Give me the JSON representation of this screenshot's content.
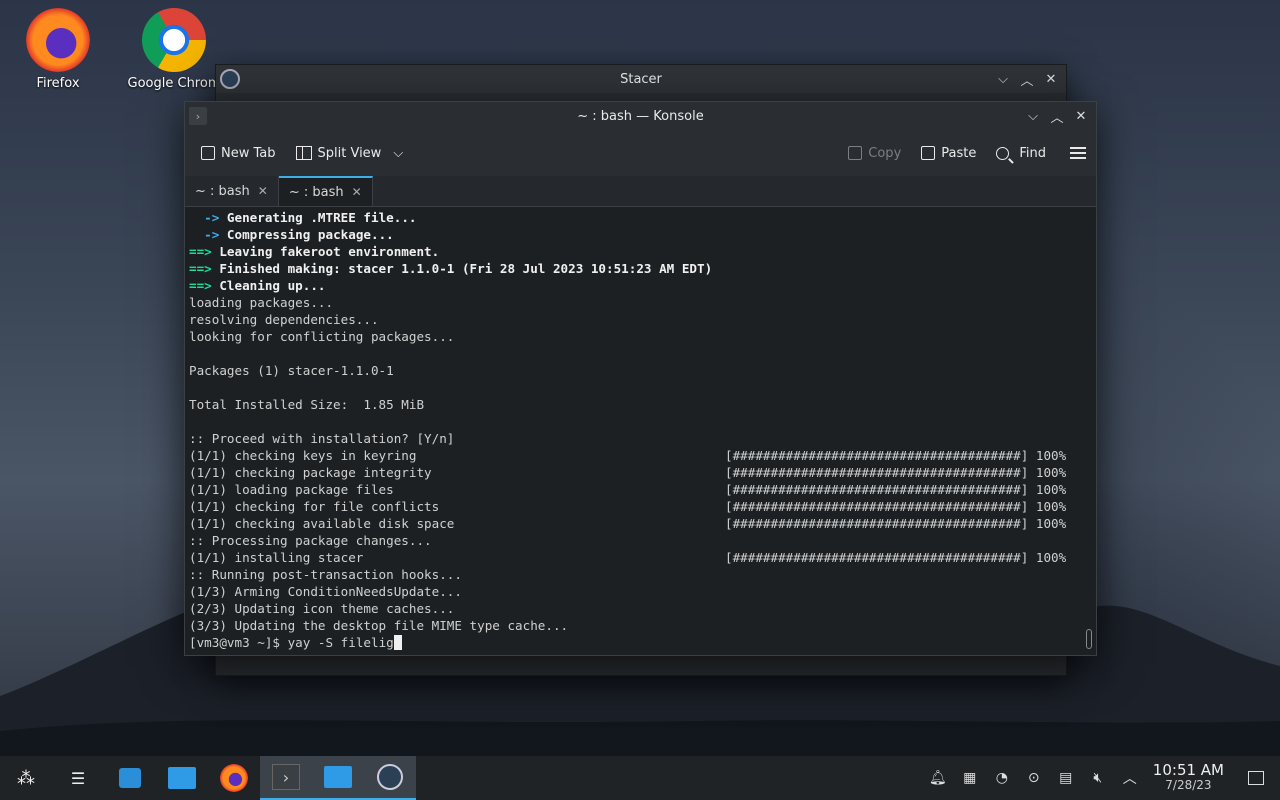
{
  "desktop": {
    "icons": [
      {
        "label": "Firefox"
      },
      {
        "label": "Google Chrom"
      }
    ]
  },
  "stacer_window": {
    "title": "Stacer"
  },
  "konsole": {
    "title": "~ : bash — Konsole",
    "toolbar": {
      "new_tab": "New Tab",
      "split_view": "Split View",
      "copy": "Copy",
      "paste": "Paste",
      "find": "Find"
    },
    "tabs": [
      {
        "label": "~ : bash"
      },
      {
        "label": "~ : bash"
      }
    ],
    "terminal": {
      "lines": [
        {
          "prefix": "  ->",
          "text": " Generating .MTREE file..."
        },
        {
          "prefix": "  ->",
          "text": " Compressing package..."
        },
        {
          "prefix": "==>",
          "text": " Leaving fakeroot environment."
        },
        {
          "prefix": "==>",
          "text": " Finished making: stacer 1.1.0-1 (Fri 28 Jul 2023 10:51:23 AM EDT)"
        },
        {
          "prefix": "==>",
          "text": " Cleaning up..."
        },
        {
          "text": "loading packages..."
        },
        {
          "text": "resolving dependencies..."
        },
        {
          "text": "looking for conflicting packages..."
        },
        {
          "text": ""
        },
        {
          "text": "Packages (1) stacer-1.1.0-1"
        },
        {
          "text": ""
        },
        {
          "text": "Total Installed Size:  1.85 MiB"
        },
        {
          "text": ""
        },
        {
          "text": ":: Proceed with installation? [Y/n]"
        },
        {
          "text": "(1/1) checking keys in keyring",
          "bar": "[######################################] 100%"
        },
        {
          "text": "(1/1) checking package integrity",
          "bar": "[######################################] 100%"
        },
        {
          "text": "(1/1) loading package files",
          "bar": "[######################################] 100%"
        },
        {
          "text": "(1/1) checking for file conflicts",
          "bar": "[######################################] 100%"
        },
        {
          "text": "(1/1) checking available disk space",
          "bar": "[######################################] 100%"
        },
        {
          "text": ":: Processing package changes..."
        },
        {
          "text": "(1/1) installing stacer",
          "bar": "[######################################] 100%"
        },
        {
          "text": ":: Running post-transaction hooks..."
        },
        {
          "text": "(1/3) Arming ConditionNeedsUpdate..."
        },
        {
          "text": "(2/3) Updating icon theme caches..."
        },
        {
          "text": "(3/3) Updating the desktop file MIME type cache..."
        }
      ],
      "prompt": "[vm3@vm3 ~]$ ",
      "command": "yay -S filelig"
    }
  },
  "taskbar": {
    "clock_time": "10:51 AM",
    "clock_date": "7/28/23"
  },
  "colors": {
    "accent": "#3daee9",
    "terminal_bg": "#1d2023",
    "arrow_green": "#1cdc9a"
  }
}
